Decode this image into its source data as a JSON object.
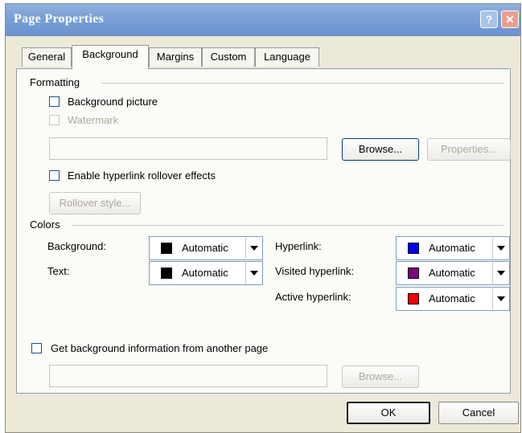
{
  "window": {
    "title": "Page Properties",
    "help_glyph": "?",
    "close_glyph": "✕"
  },
  "tabs": [
    {
      "label": "General"
    },
    {
      "label": "Background"
    },
    {
      "label": "Margins"
    },
    {
      "label": "Custom"
    },
    {
      "label": "Language"
    }
  ],
  "formatting": {
    "heading": "Formatting",
    "background_picture": "Background picture",
    "watermark": "Watermark",
    "picture_path": "",
    "browse": "Browse...",
    "properties": "Properties...",
    "enable_rollover": "Enable hyperlink rollover effects",
    "rollover_style": "Rollover style..."
  },
  "colors": {
    "heading": "Colors",
    "left": [
      {
        "label": "Background:",
        "value": "Automatic",
        "swatch": "#000000"
      },
      {
        "label": "Text:",
        "value": "Automatic",
        "swatch": "#000000"
      }
    ],
    "right": [
      {
        "label": "Hyperlink:",
        "value": "Automatic",
        "swatch": "#0000ff"
      },
      {
        "label": "Visited hyperlink:",
        "value": "Automatic",
        "swatch": "#800080"
      },
      {
        "label": "Active hyperlink:",
        "value": "Automatic",
        "swatch": "#ff0000"
      }
    ]
  },
  "get_background": {
    "label": "Get background information from another page",
    "path": "",
    "browse": "Browse..."
  },
  "footer": {
    "ok": "OK",
    "cancel": "Cancel"
  }
}
